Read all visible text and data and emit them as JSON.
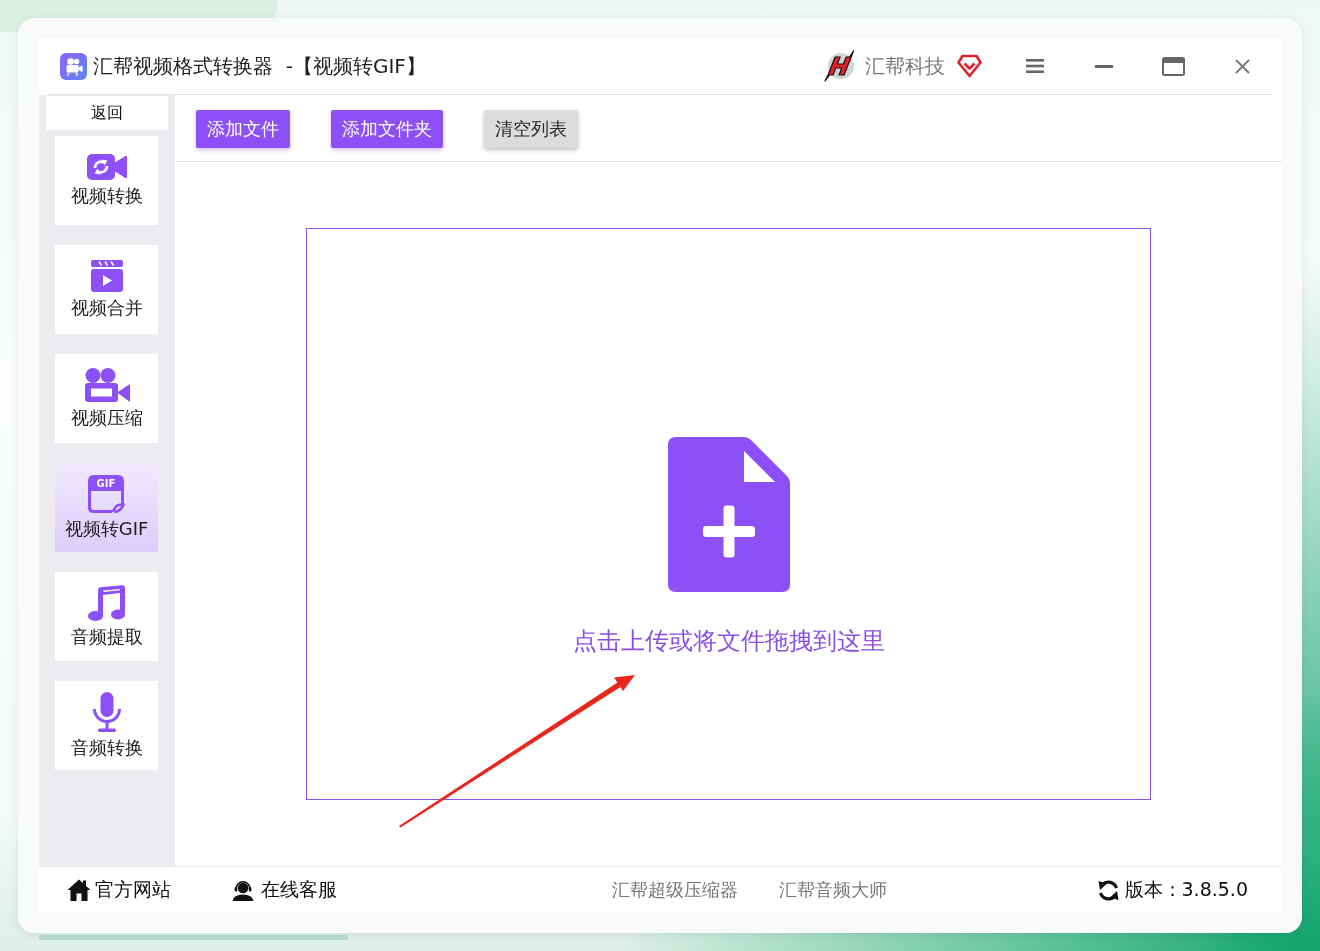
{
  "window": {
    "title": "汇帮视频格式转换器  -【视频转GIF】",
    "brand": "汇帮科技"
  },
  "sidebar": {
    "back": "返回",
    "items": [
      {
        "label": "视频转换",
        "selected": false
      },
      {
        "label": "视频合并",
        "selected": false
      },
      {
        "label": "视频压缩",
        "selected": false
      },
      {
        "label": "视频转GIF",
        "selected": true,
        "icon_text": "GIF"
      },
      {
        "label": "音频提取",
        "selected": false
      },
      {
        "label": "音频转换",
        "selected": false
      }
    ]
  },
  "toolbar": {
    "buttons": [
      {
        "label": "添加文件",
        "kind": "primary"
      },
      {
        "label": "添加文件夹",
        "kind": "primary"
      },
      {
        "label": "清空列表",
        "kind": "secondary"
      }
    ]
  },
  "drop_zone": {
    "hint": "点击上传或将文件拖拽到这里"
  },
  "footer": {
    "links": [
      "官方网站",
      "在线客服"
    ],
    "products": [
      "汇帮超级压缩器",
      "汇帮音频大师"
    ],
    "version": "版本：3.8.5.0"
  }
}
